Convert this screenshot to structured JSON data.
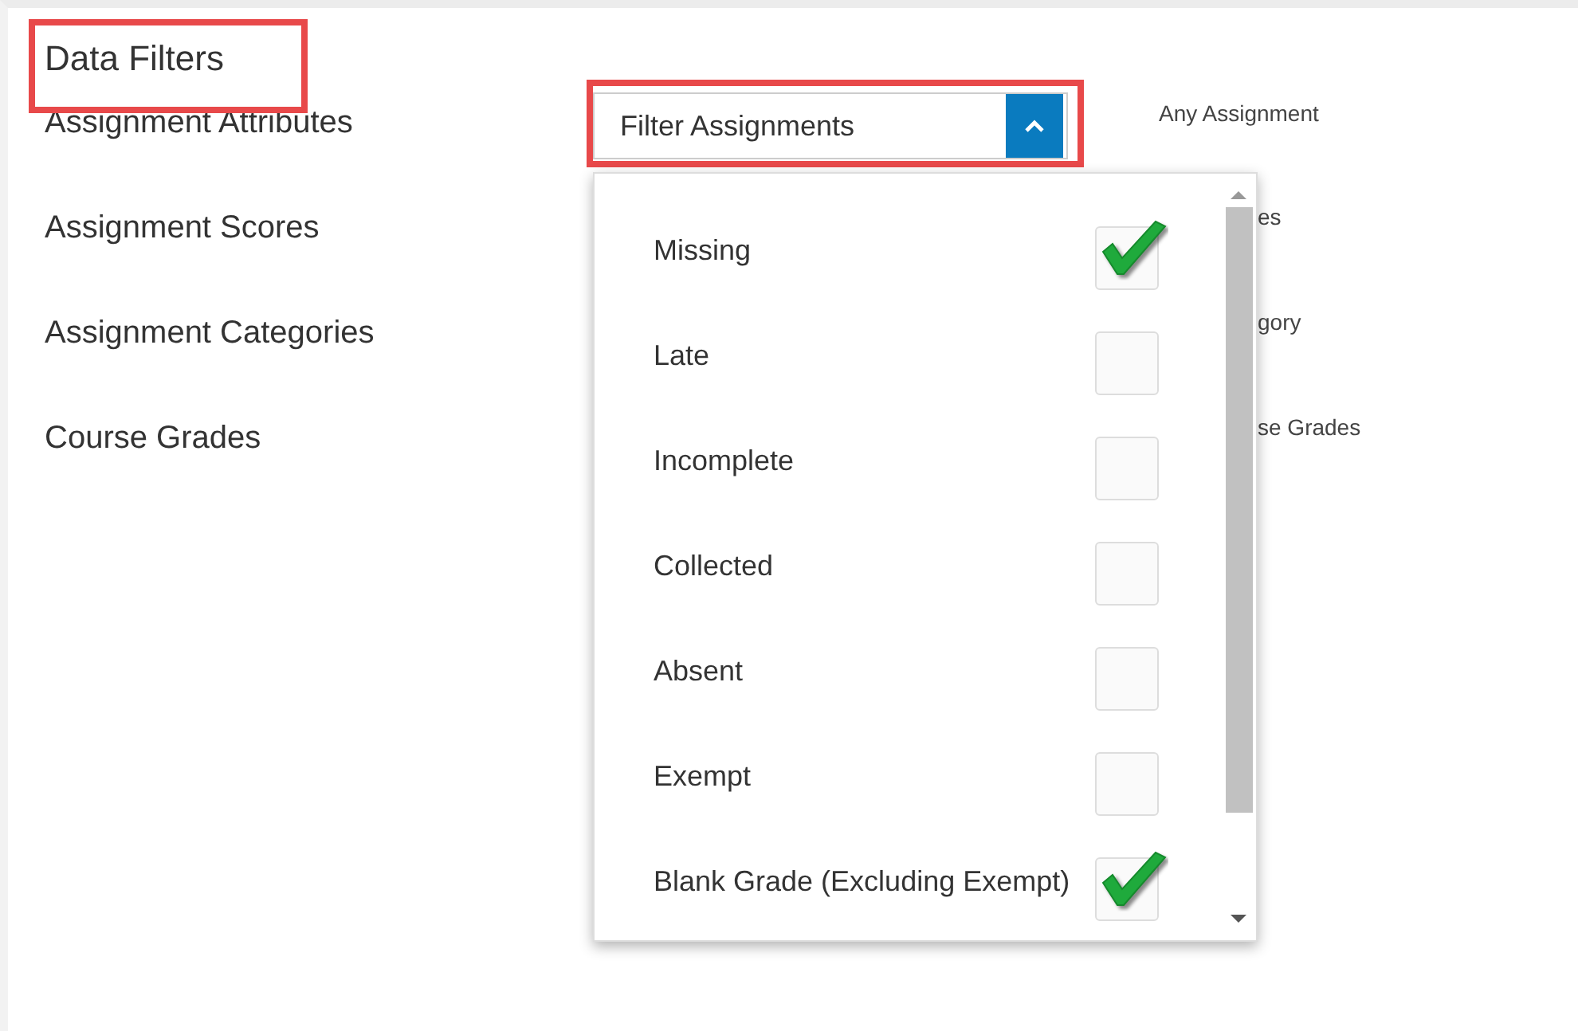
{
  "title": {
    "text": "Data Filters",
    "highlighted": true
  },
  "filters": [
    {
      "label": "Assignment Attributes",
      "dropdown": {
        "text": "Filter Assignments",
        "expanded": true,
        "highlighted": true
      },
      "summary": "Any Assignment"
    },
    {
      "label": "Assignment Scores",
      "summary": "es"
    },
    {
      "label": "Assignment Categories",
      "summary": "gory"
    },
    {
      "label": "Course Grades",
      "summary": "se Grades"
    }
  ],
  "options": [
    {
      "label": "Missing",
      "checked": true
    },
    {
      "label": "Late",
      "checked": false
    },
    {
      "label": "Incomplete",
      "checked": false
    },
    {
      "label": "Collected",
      "checked": false
    },
    {
      "label": "Absent",
      "checked": false
    },
    {
      "label": "Exempt",
      "checked": false
    },
    {
      "label": "Blank Grade (Excluding Exempt)",
      "checked": true
    }
  ]
}
